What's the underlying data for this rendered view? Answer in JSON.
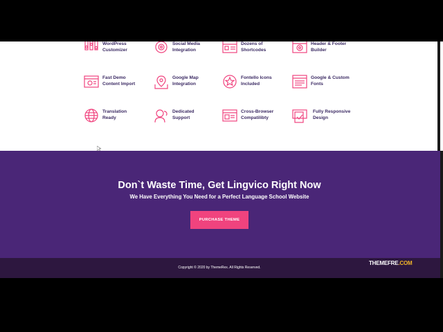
{
  "features": [
    {
      "icon": "wordpress-customizer-icon",
      "label": "WordPress\nCustomizer"
    },
    {
      "icon": "social-media-icon",
      "label": "Social Media\nIntegration"
    },
    {
      "icon": "shortcodes-icon",
      "label": "Dozens of\nShortcodes"
    },
    {
      "icon": "header-footer-builder-icon",
      "label": "Header & Footer\nBuilder"
    },
    {
      "icon": "demo-import-icon",
      "label": "Fast Demo\nContent Import"
    },
    {
      "icon": "google-map-icon",
      "label": "Google Map\nIntegration"
    },
    {
      "icon": "fontello-icons-icon",
      "label": "Fontello Icons\nIncluded"
    },
    {
      "icon": "google-fonts-icon",
      "label": "Google & Custom\nFonts"
    },
    {
      "icon": "globe-icon",
      "label": "Translation\nReady"
    },
    {
      "icon": "support-icon",
      "label": "Dedicated\nSupport"
    },
    {
      "icon": "cross-browser-icon",
      "label": "Cross-Browser\nCompatilibty"
    },
    {
      "icon": "responsive-design-icon",
      "label": "Fully Responsive\nDesign"
    }
  ],
  "cta": {
    "title": "Don`t Waste Time, Get Lingvico Right Now",
    "subtitle": "We Have Everything You Need for a Perfect Language School Website",
    "button_label": "PURCHASE THEME"
  },
  "footer": {
    "copyright": "Copyright © 2020 by ThemeRex. All Rights Reserved.",
    "brand_part1": "THEMEFRE",
    "brand_part2": ".COM"
  },
  "colors": {
    "accent": "#f0437e",
    "cta_background": "#4a2677",
    "footer_background": "#2d173f",
    "label_text": "#3b2a63",
    "brand_highlight": "#f0b429"
  }
}
